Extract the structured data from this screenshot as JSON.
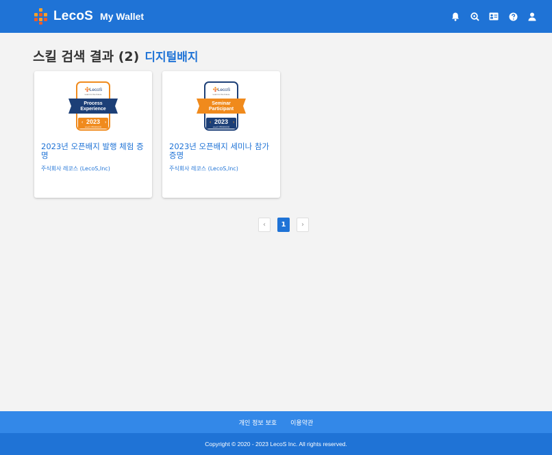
{
  "header": {
    "brand": "LecoS",
    "subtitle": "My Wallet",
    "icons": [
      "bell-icon",
      "search-icon",
      "id-card-icon",
      "help-icon",
      "user-icon"
    ]
  },
  "heading": {
    "title": "스킬 검색 결과 (2)",
    "category": "디지털배지"
  },
  "cards": [
    {
      "title": "2023년 오픈배지 발행 체험 증명",
      "issuer": "주식회사 레코스 (LecoS,Inc)",
      "badge": {
        "logo": "LecoS",
        "tagline": "Learn for the Future",
        "banner_line1": "Process",
        "banner_line2": "Experience",
        "year": "2023",
        "footer": "LecoS OPENBADGE",
        "border_color": "#f08a1c",
        "banner_color": "#1c3f77",
        "year_bg": "#f08a1c"
      }
    },
    {
      "title": "2023년 오픈배지 세미나 참가 증명",
      "issuer": "주식회사 레코스 (LecoS,Inc)",
      "badge": {
        "logo": "LecoS",
        "tagline": "Learn for the Future",
        "banner_line1": "Seminar",
        "banner_line2": "Participant",
        "year": "2023",
        "footer": "LecoS OPENBADGE",
        "border_color": "#1c3f77",
        "banner_color": "#f08a1c",
        "year_bg": "#1c3f77"
      }
    }
  ],
  "pagination": {
    "prev": "‹",
    "current": "1",
    "next": "›"
  },
  "footer": {
    "privacy": "개인 정보 보호",
    "terms": "이용약관",
    "copyright": "Copyright © 2020 - 2023 LecoS Inc. All rights reserved."
  }
}
